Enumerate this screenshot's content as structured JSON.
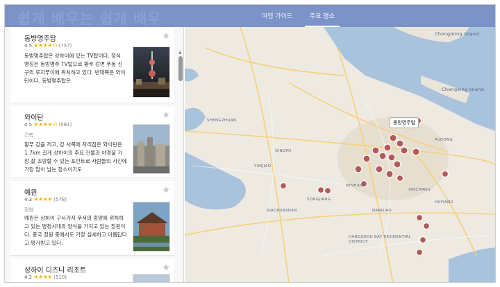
{
  "header": {
    "brand": "쉽게 배우는 쉽게 배우",
    "tabs": [
      {
        "label": "여행 가이드",
        "active": false
      },
      {
        "label": "주요 명소",
        "active": true
      }
    ]
  },
  "attractions": [
    {
      "title": "동방명주탑",
      "rating": "4.5",
      "stars": "★★★★½",
      "count": "(757)",
      "category": "",
      "description": "동방명주탑은 상하이에 있는 TV탑이다. 정식 명칭은 동방명주 TV탑으로 황푸 강변 푸동 신구의 루자쭈이에 위치하고 있다. 반대쪽은 와이탄이다. 동방명주탑은"
    },
    {
      "title": "와이탄",
      "rating": "4.5",
      "stars": "★★★★½",
      "count": "(581)",
      "category": "건축",
      "description": "황푸 강을 끼고, 강 서쪽에 자리잡은 와이탄은 1.7km 길게 상하이의 주요 건물과 야경을 가장 잘 조망할 수 있는 포인트로 사람들의 사진에 가장 많이 남는 장소이기도"
    },
    {
      "title": "예원",
      "rating": "4.3",
      "stars": "★★★★",
      "count": "(578)",
      "category": "정원",
      "description": "예원은 상하이 구시가지 푸서의 중앙에 위치하고 있는 명청시대의 양식을 가지고 있는 정원이다. 중국 정원 중에서도 가장 섬세하고 아름답다고 평가받고 있다."
    },
    {
      "title": "상하이 디즈니 리조트",
      "rating": "4.2",
      "stars": "★★★★",
      "count": "(510)",
      "category": "",
      "description": ""
    }
  ],
  "map": {
    "tooltip": "동방명주탑",
    "labels": [
      {
        "text": "Chongming Island",
        "name": "chongming-island"
      },
      {
        "text": "Changxing Island",
        "name": "changxing-island"
      },
      {
        "text": "SHENGZHUAN",
        "name": "shengzhuan"
      },
      {
        "text": "YUEJIAO",
        "name": "yuejiao"
      },
      {
        "text": "QINGPU",
        "name": "qingpu"
      },
      {
        "text": "SONGJIANG",
        "name": "songjiang"
      },
      {
        "text": "MINHANG",
        "name": "minhang"
      },
      {
        "text": "PUDONG",
        "name": "pudong"
      },
      {
        "text": "XINCHANG",
        "name": "xinchang"
      },
      {
        "text": "HUIYANG",
        "name": "huiyang"
      },
      {
        "text": "NANQIAO",
        "name": "nanqiao"
      },
      {
        "text": "XIAOKUNSHAN",
        "name": "xiaokunshan"
      },
      {
        "text": "HANGZHOU BAY RESIDENTIAL DISTRICT",
        "name": "hangzhou-bay"
      }
    ]
  },
  "colors": {
    "header": "#7b93c7",
    "marker": "#b45a5a",
    "water": "#a9c3dd",
    "land": "#eeeae1",
    "road": "#f6cf7a"
  }
}
